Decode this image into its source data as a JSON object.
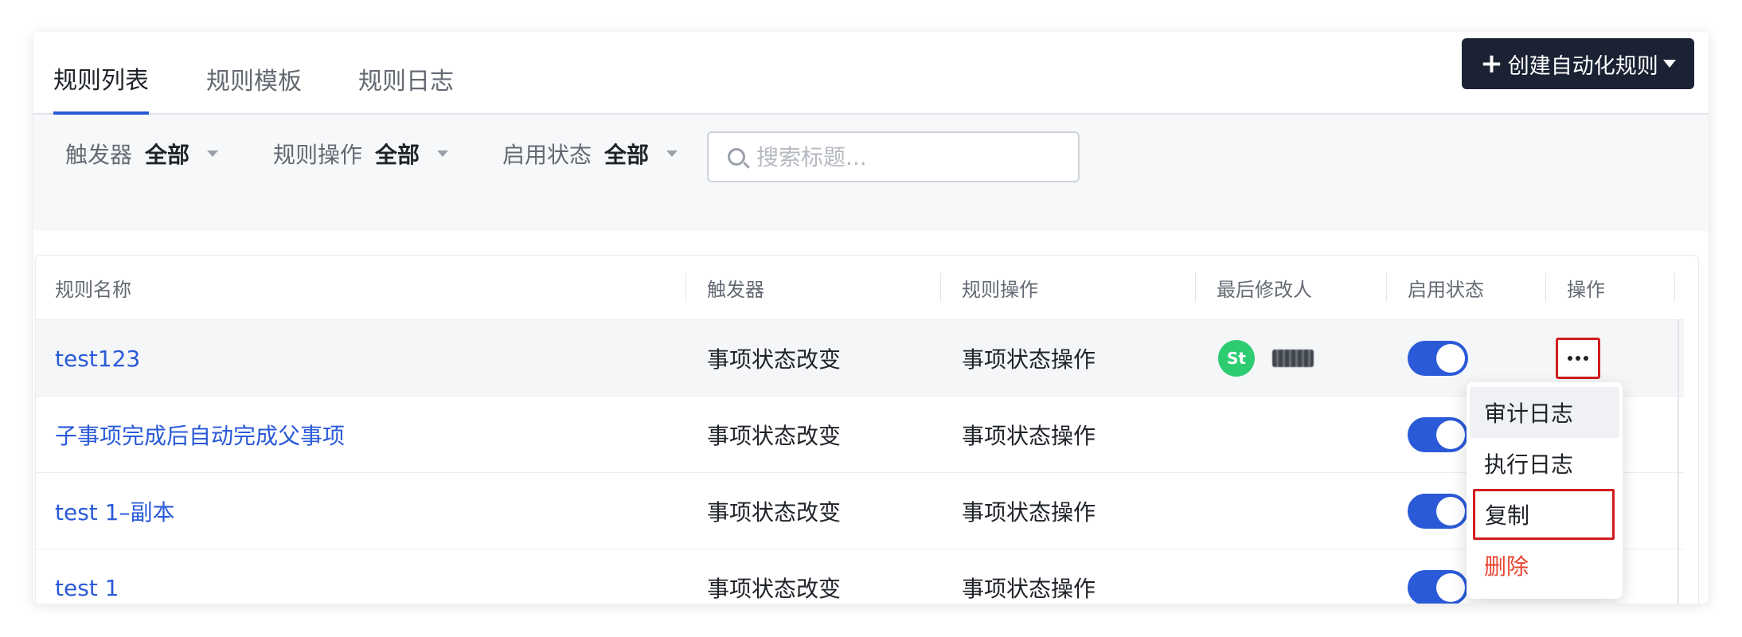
{
  "tabs": [
    {
      "label": "规则列表",
      "active": true
    },
    {
      "label": "规则模板",
      "active": false
    },
    {
      "label": "规则日志",
      "active": false
    }
  ],
  "create_button": {
    "label": "创建自动化规则"
  },
  "filters": [
    {
      "label": "触发器",
      "value": "全部"
    },
    {
      "label": "规则操作",
      "value": "全部"
    },
    {
      "label": "启用状态",
      "value": "全部"
    }
  ],
  "search": {
    "placeholder": "搜索标题...",
    "value": ""
  },
  "table": {
    "columns": [
      "规则名称",
      "触发器",
      "规则操作",
      "最后修改人",
      "启用状态",
      "操作"
    ],
    "rows": [
      {
        "name": "test123",
        "trigger": "事项状态改变",
        "action": "事项状态操作",
        "modifier_avatar": "St",
        "enabled": true
      },
      {
        "name": "子事项完成后自动完成父事项",
        "trigger": "事项状态改变",
        "action": "事项状态操作",
        "modifier_avatar": "",
        "enabled": true
      },
      {
        "name": "test 1–副本",
        "trigger": "事项状态改变",
        "action": "事项状态操作",
        "modifier_avatar": "",
        "enabled": true
      },
      {
        "name": "test 1",
        "trigger": "事项状态改变",
        "action": "事项状态操作",
        "modifier_avatar": "",
        "enabled": true
      }
    ]
  },
  "row_menu": {
    "items": [
      {
        "label": "审计日志"
      },
      {
        "label": "执行日志"
      },
      {
        "label": "复制"
      },
      {
        "label": "删除"
      }
    ]
  },
  "colors": {
    "accent": "#2a5ad7",
    "header_button": "#1a2233",
    "danger": "#e8442f",
    "highlight_box": "#d11d1d",
    "avatar": "#2ecc71"
  }
}
